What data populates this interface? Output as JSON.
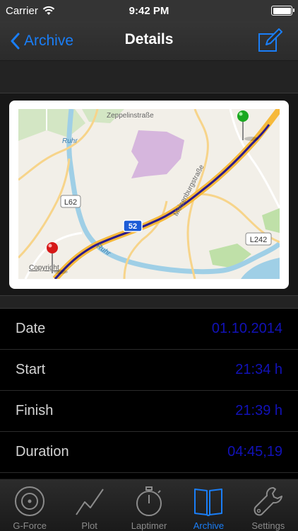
{
  "status_bar": {
    "carrier": "Carrier",
    "time": "9:42 PM",
    "battery_level": 1.0
  },
  "nav": {
    "back_label": "Archive",
    "title": "Details",
    "edit_icon": "compose-icon"
  },
  "map": {
    "labels": {
      "street_top": "Zeppelinstraße",
      "river_top": "Ruhr",
      "road_l62": "L62",
      "road_b52": "52",
      "street_meisenburg": "Meisenburgstraße",
      "river_bottom": "Ruhr",
      "road_l242": "L242",
      "copyright": "Copyright"
    },
    "start_pin_color": "#d61818",
    "end_pin_color": "#1aa820",
    "route_color": "#2b1a8c"
  },
  "details": [
    {
      "label": "Date",
      "value": "01.10.2014"
    },
    {
      "label": "Start",
      "value": "21:34 h"
    },
    {
      "label": "Finish",
      "value": "21:39 h"
    },
    {
      "label": "Duration",
      "value": "04:45,19"
    }
  ],
  "tabs": [
    {
      "label": "G-Force",
      "icon": "target-icon",
      "active": false
    },
    {
      "label": "Plot",
      "icon": "line-graph-icon",
      "active": false
    },
    {
      "label": "Laptimer",
      "icon": "stopwatch-icon",
      "active": false
    },
    {
      "label": "Archive",
      "icon": "book-icon",
      "active": true
    },
    {
      "label": "Settings",
      "icon": "wrench-icon",
      "active": false
    }
  ],
  "colors": {
    "accent": "#1a7ef7",
    "value_text": "#1212b8"
  }
}
